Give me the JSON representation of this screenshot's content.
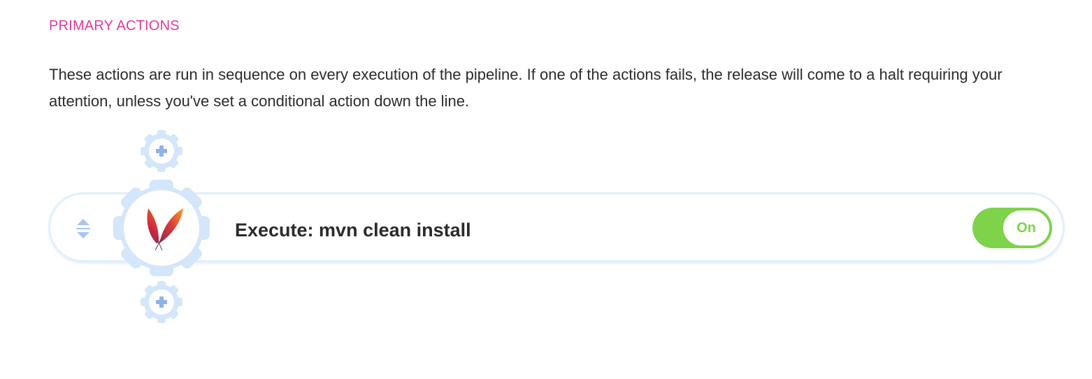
{
  "section": {
    "title": "PRIMARY ACTIONS",
    "description": "These actions are run in sequence on every execution of the pipeline. If one of the actions fails, the release will come to a halt requiring your attention, unless you've set a conditional action down the line."
  },
  "action": {
    "label": "Execute: mvn clean install",
    "icon": "apache-maven-feather-icon",
    "toggle": {
      "label": "On",
      "state": "on"
    }
  },
  "colors": {
    "title_accent": "#e3399b",
    "toggle_on": "#7ed34a",
    "gear_light_blue": "#d4e6fa",
    "plus_blue": "#8fb3e4"
  }
}
